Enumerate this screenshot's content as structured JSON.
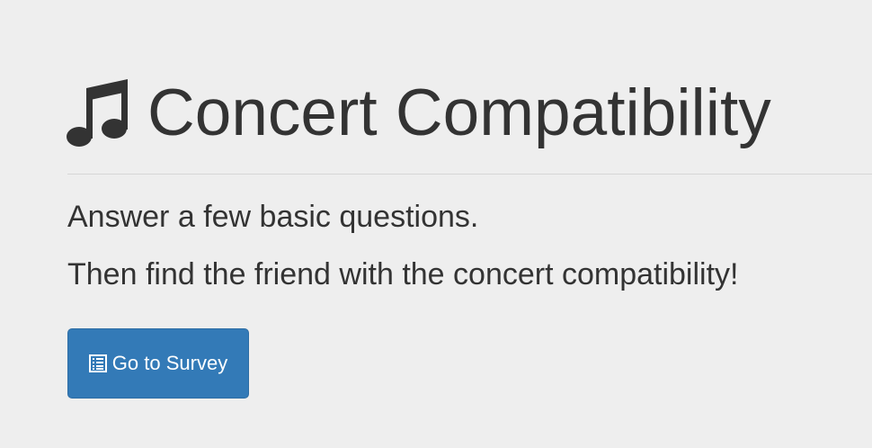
{
  "header": {
    "icon": "music-note-icon",
    "title": "Concert Compatibility"
  },
  "intro": {
    "line1": "Answer a few basic questions.",
    "line2": "Then find the friend with the concert compatibility!"
  },
  "actions": {
    "survey_button": {
      "icon": "list-alt-icon",
      "label": "Go to Survey"
    }
  },
  "colors": {
    "background": "#eeeeee",
    "text": "#333333",
    "button": "#337ab7",
    "button_text": "#ffffff"
  }
}
